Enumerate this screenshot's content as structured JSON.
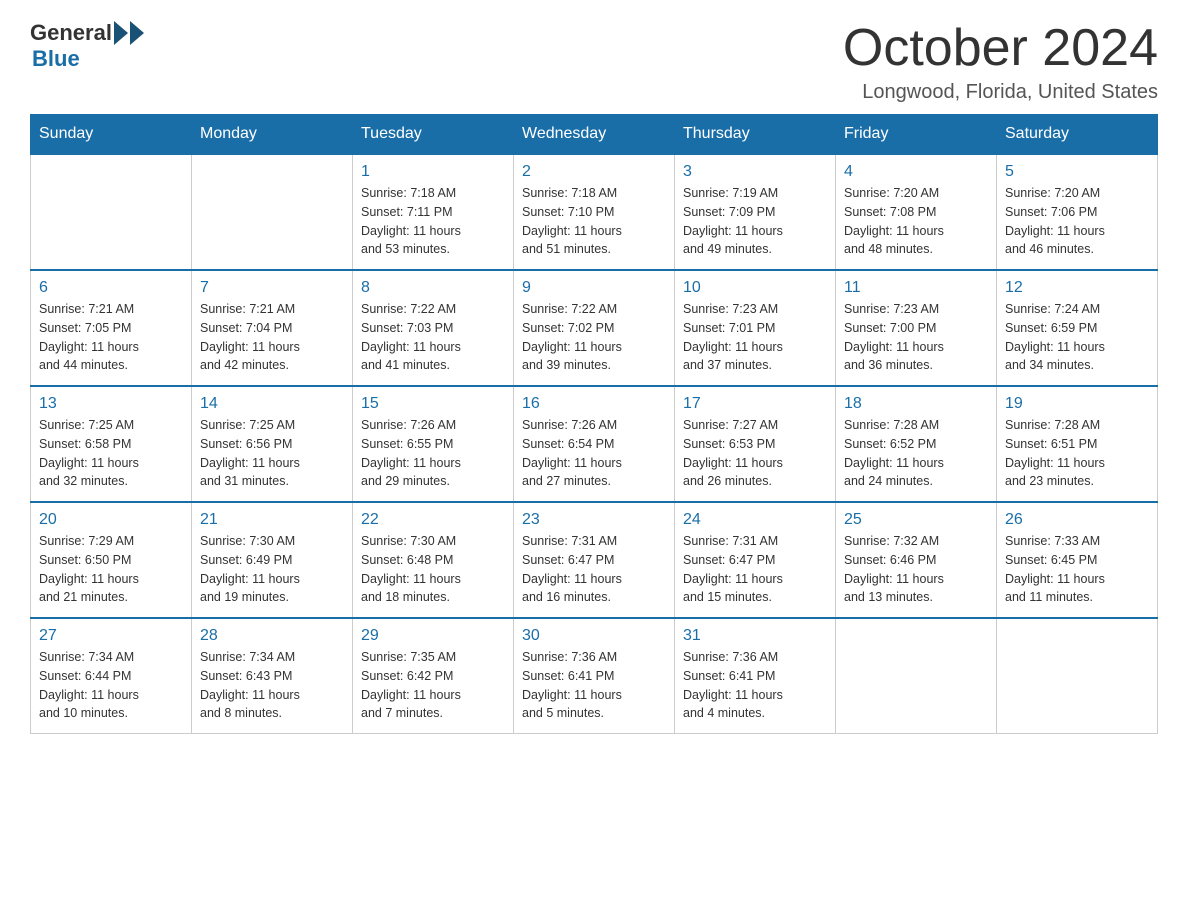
{
  "logo": {
    "general": "General",
    "blue": "Blue"
  },
  "title": "October 2024",
  "location": "Longwood, Florida, United States",
  "days_of_week": [
    "Sunday",
    "Monday",
    "Tuesday",
    "Wednesday",
    "Thursday",
    "Friday",
    "Saturday"
  ],
  "weeks": [
    [
      {
        "day": "",
        "info": ""
      },
      {
        "day": "",
        "info": ""
      },
      {
        "day": "1",
        "info": "Sunrise: 7:18 AM\nSunset: 7:11 PM\nDaylight: 11 hours\nand 53 minutes."
      },
      {
        "day": "2",
        "info": "Sunrise: 7:18 AM\nSunset: 7:10 PM\nDaylight: 11 hours\nand 51 minutes."
      },
      {
        "day": "3",
        "info": "Sunrise: 7:19 AM\nSunset: 7:09 PM\nDaylight: 11 hours\nand 49 minutes."
      },
      {
        "day": "4",
        "info": "Sunrise: 7:20 AM\nSunset: 7:08 PM\nDaylight: 11 hours\nand 48 minutes."
      },
      {
        "day": "5",
        "info": "Sunrise: 7:20 AM\nSunset: 7:06 PM\nDaylight: 11 hours\nand 46 minutes."
      }
    ],
    [
      {
        "day": "6",
        "info": "Sunrise: 7:21 AM\nSunset: 7:05 PM\nDaylight: 11 hours\nand 44 minutes."
      },
      {
        "day": "7",
        "info": "Sunrise: 7:21 AM\nSunset: 7:04 PM\nDaylight: 11 hours\nand 42 minutes."
      },
      {
        "day": "8",
        "info": "Sunrise: 7:22 AM\nSunset: 7:03 PM\nDaylight: 11 hours\nand 41 minutes."
      },
      {
        "day": "9",
        "info": "Sunrise: 7:22 AM\nSunset: 7:02 PM\nDaylight: 11 hours\nand 39 minutes."
      },
      {
        "day": "10",
        "info": "Sunrise: 7:23 AM\nSunset: 7:01 PM\nDaylight: 11 hours\nand 37 minutes."
      },
      {
        "day": "11",
        "info": "Sunrise: 7:23 AM\nSunset: 7:00 PM\nDaylight: 11 hours\nand 36 minutes."
      },
      {
        "day": "12",
        "info": "Sunrise: 7:24 AM\nSunset: 6:59 PM\nDaylight: 11 hours\nand 34 minutes."
      }
    ],
    [
      {
        "day": "13",
        "info": "Sunrise: 7:25 AM\nSunset: 6:58 PM\nDaylight: 11 hours\nand 32 minutes."
      },
      {
        "day": "14",
        "info": "Sunrise: 7:25 AM\nSunset: 6:56 PM\nDaylight: 11 hours\nand 31 minutes."
      },
      {
        "day": "15",
        "info": "Sunrise: 7:26 AM\nSunset: 6:55 PM\nDaylight: 11 hours\nand 29 minutes."
      },
      {
        "day": "16",
        "info": "Sunrise: 7:26 AM\nSunset: 6:54 PM\nDaylight: 11 hours\nand 27 minutes."
      },
      {
        "day": "17",
        "info": "Sunrise: 7:27 AM\nSunset: 6:53 PM\nDaylight: 11 hours\nand 26 minutes."
      },
      {
        "day": "18",
        "info": "Sunrise: 7:28 AM\nSunset: 6:52 PM\nDaylight: 11 hours\nand 24 minutes."
      },
      {
        "day": "19",
        "info": "Sunrise: 7:28 AM\nSunset: 6:51 PM\nDaylight: 11 hours\nand 23 minutes."
      }
    ],
    [
      {
        "day": "20",
        "info": "Sunrise: 7:29 AM\nSunset: 6:50 PM\nDaylight: 11 hours\nand 21 minutes."
      },
      {
        "day": "21",
        "info": "Sunrise: 7:30 AM\nSunset: 6:49 PM\nDaylight: 11 hours\nand 19 minutes."
      },
      {
        "day": "22",
        "info": "Sunrise: 7:30 AM\nSunset: 6:48 PM\nDaylight: 11 hours\nand 18 minutes."
      },
      {
        "day": "23",
        "info": "Sunrise: 7:31 AM\nSunset: 6:47 PM\nDaylight: 11 hours\nand 16 minutes."
      },
      {
        "day": "24",
        "info": "Sunrise: 7:31 AM\nSunset: 6:47 PM\nDaylight: 11 hours\nand 15 minutes."
      },
      {
        "day": "25",
        "info": "Sunrise: 7:32 AM\nSunset: 6:46 PM\nDaylight: 11 hours\nand 13 minutes."
      },
      {
        "day": "26",
        "info": "Sunrise: 7:33 AM\nSunset: 6:45 PM\nDaylight: 11 hours\nand 11 minutes."
      }
    ],
    [
      {
        "day": "27",
        "info": "Sunrise: 7:34 AM\nSunset: 6:44 PM\nDaylight: 11 hours\nand 10 minutes."
      },
      {
        "day": "28",
        "info": "Sunrise: 7:34 AM\nSunset: 6:43 PM\nDaylight: 11 hours\nand 8 minutes."
      },
      {
        "day": "29",
        "info": "Sunrise: 7:35 AM\nSunset: 6:42 PM\nDaylight: 11 hours\nand 7 minutes."
      },
      {
        "day": "30",
        "info": "Sunrise: 7:36 AM\nSunset: 6:41 PM\nDaylight: 11 hours\nand 5 minutes."
      },
      {
        "day": "31",
        "info": "Sunrise: 7:36 AM\nSunset: 6:41 PM\nDaylight: 11 hours\nand 4 minutes."
      },
      {
        "day": "",
        "info": ""
      },
      {
        "day": "",
        "info": ""
      }
    ]
  ]
}
